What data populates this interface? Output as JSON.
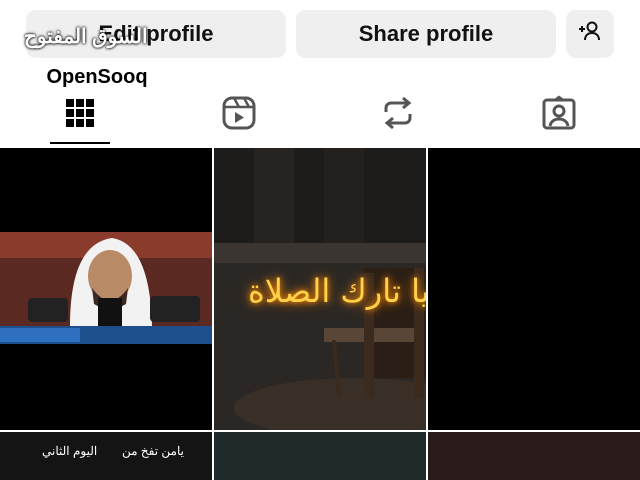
{
  "buttons": {
    "edit_profile": "Edit profile",
    "share_profile": "Share profile"
  },
  "watermark": {
    "arabic": "السوق المفتوح",
    "brand": "OpenSooq"
  },
  "tabs": [
    {
      "icon": "grid-icon",
      "active": true
    },
    {
      "icon": "reels-icon",
      "active": false
    },
    {
      "icon": "reposts-icon",
      "active": false
    },
    {
      "icon": "tagged-icon",
      "active": false
    }
  ],
  "tiles": {
    "tile2_text": "يا تارك الصلاة",
    "tile4_left": "اليوم الثاني",
    "tile4_right": "يامن تفخ من"
  },
  "colors": {
    "button_bg": "#efefef",
    "neon": "#ffd24a"
  }
}
